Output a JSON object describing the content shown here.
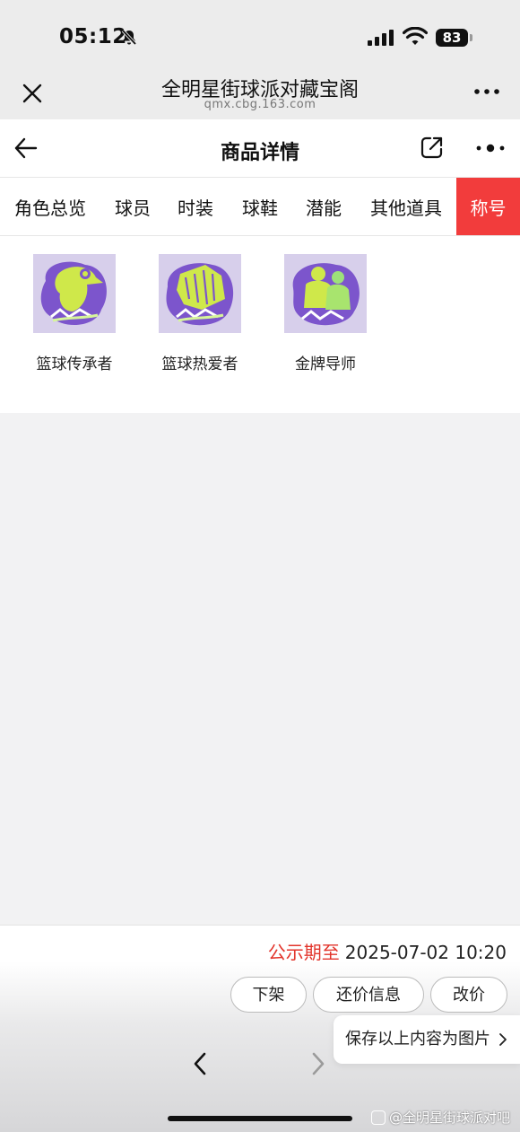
{
  "status_bar": {
    "time": "05:12",
    "battery": "83"
  },
  "browser": {
    "title": "全明星街球派对藏宝阁",
    "url": "qmx.cbg.163.com"
  },
  "header": {
    "title": "商品详情"
  },
  "tabs": [
    {
      "label": "角色总览",
      "active": false
    },
    {
      "label": "球员",
      "active": false
    },
    {
      "label": "时装",
      "active": false
    },
    {
      "label": "球鞋",
      "active": false
    },
    {
      "label": "潜能",
      "active": false
    },
    {
      "label": "其他道具",
      "active": false
    },
    {
      "label": "称号",
      "active": true
    }
  ],
  "titles": [
    {
      "label": "篮球传承者"
    },
    {
      "label": "篮球热爱者"
    },
    {
      "label": "金牌导师"
    }
  ],
  "footer": {
    "deadline_label": "公示期至",
    "deadline_value": "2025-07-02 10:20",
    "buttons": {
      "delist": "下架",
      "counter_offer": "还价信息",
      "change_price": "改价"
    },
    "save_tip": "保存以上内容为图片",
    "watermark": "@全明星街球派对吧"
  },
  "colors": {
    "accent": "#f23c3c",
    "badge_bg": "#d9d2ec",
    "badge_purple": "#7b52c8",
    "badge_lime": "#d4ef3c"
  }
}
